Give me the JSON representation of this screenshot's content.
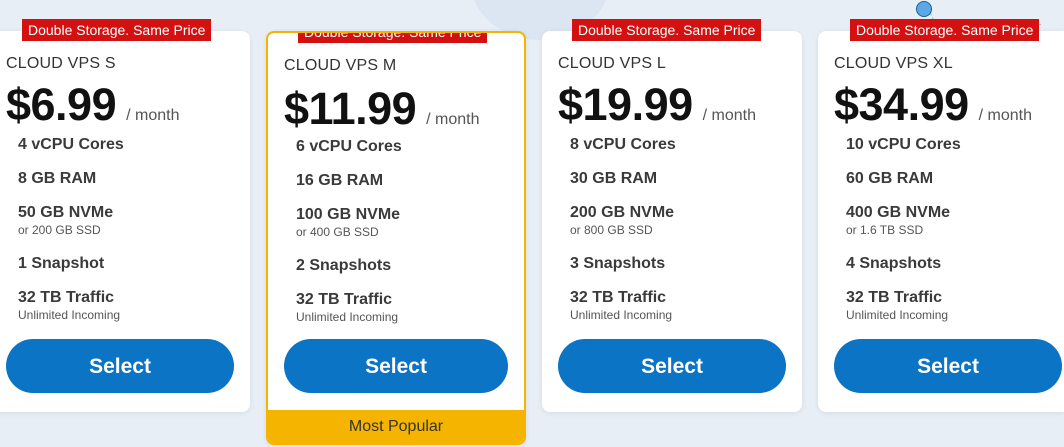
{
  "plans": [
    {
      "badge": "Double Storage. Same Price",
      "name": "CLOUD VPS S",
      "price": "$6.99",
      "period": "/ month",
      "features": [
        {
          "main": "4 vCPU Cores",
          "sub": ""
        },
        {
          "main": "8 GB RAM",
          "sub": ""
        },
        {
          "main": "50 GB NVMe",
          "sub": "or 200 GB SSD"
        },
        {
          "main": "1 Snapshot",
          "sub": ""
        },
        {
          "main": "32 TB Traffic",
          "sub": "Unlimited Incoming"
        }
      ],
      "button": "Select"
    },
    {
      "badge": "Double Storage. Same Price",
      "name": "CLOUD VPS M",
      "price": "$11.99",
      "period": "/ month",
      "features": [
        {
          "main": "6 vCPU Cores",
          "sub": ""
        },
        {
          "main": "16 GB RAM",
          "sub": ""
        },
        {
          "main": "100 GB NVMe",
          "sub": "or 400 GB SSD"
        },
        {
          "main": "2 Snapshots",
          "sub": ""
        },
        {
          "main": "32 TB Traffic",
          "sub": "Unlimited Incoming"
        }
      ],
      "button": "Select",
      "ribbon": "Most Popular"
    },
    {
      "badge": "Double Storage. Same Price",
      "name": "CLOUD VPS L",
      "price": "$19.99",
      "period": "/ month",
      "features": [
        {
          "main": "8 vCPU Cores",
          "sub": ""
        },
        {
          "main": "30 GB RAM",
          "sub": ""
        },
        {
          "main": "200 GB NVMe",
          "sub": "or 800 GB SSD"
        },
        {
          "main": "3 Snapshots",
          "sub": ""
        },
        {
          "main": "32 TB Traffic",
          "sub": "Unlimited Incoming"
        }
      ],
      "button": "Select"
    },
    {
      "badge": "Double Storage. Same Price",
      "name": "CLOUD VPS XL",
      "price": "$34.99",
      "period": "/ month",
      "features": [
        {
          "main": "10 vCPU Cores",
          "sub": ""
        },
        {
          "main": "60 GB RAM",
          "sub": ""
        },
        {
          "main": "400 GB NVMe",
          "sub": "or 1.6 TB SSD"
        },
        {
          "main": "4 Snapshots",
          "sub": ""
        },
        {
          "main": "32 TB Traffic",
          "sub": "Unlimited Incoming"
        }
      ],
      "button": "Select"
    }
  ],
  "colors": {
    "badge": "#d41111",
    "button": "#0b74c4",
    "featured_border": "#f5b400",
    "background": "#e8eef6"
  }
}
